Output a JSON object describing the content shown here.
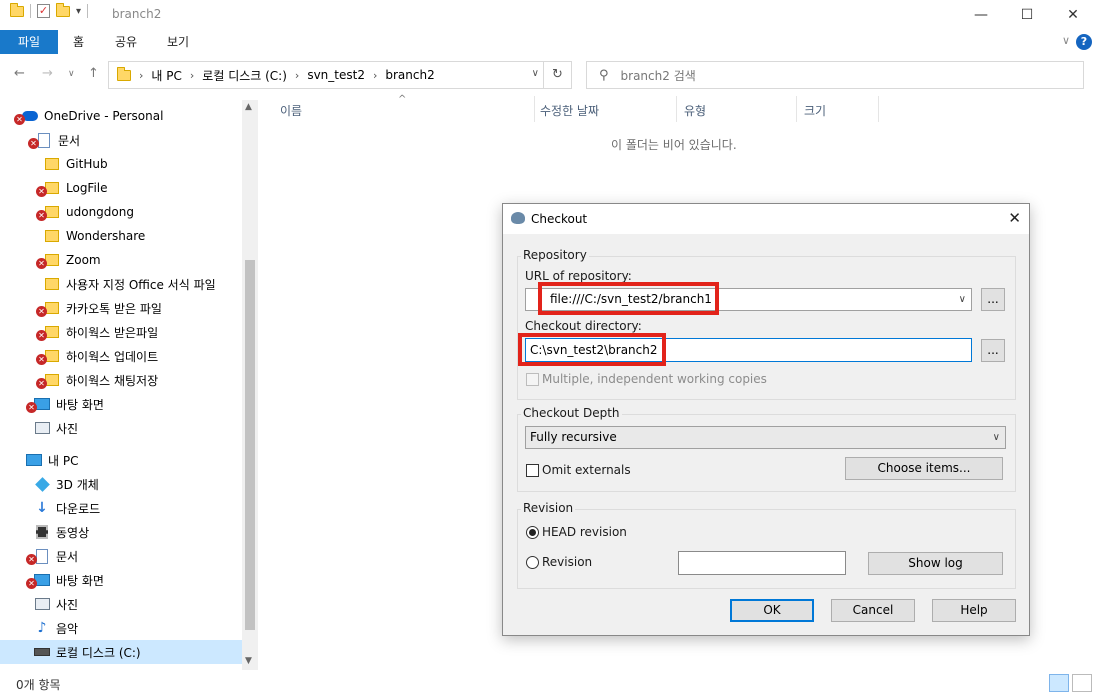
{
  "window": {
    "title": "branch2"
  },
  "ribbon": {
    "tabs": [
      "파일",
      "홈",
      "공유",
      "보기"
    ]
  },
  "address": {
    "crumbs": [
      "내 PC",
      "로컬 디스크 (C:)",
      "svn_test2",
      "branch2"
    ]
  },
  "search": {
    "placeholder": "branch2 검색"
  },
  "nav": {
    "items": [
      {
        "label": "OneDrive - Personal",
        "icon": "cloud-icon",
        "error": true
      },
      {
        "label": "문서",
        "icon": "document-icon",
        "error": true
      },
      {
        "label": "GitHub",
        "icon": "folder-icon",
        "error": false
      },
      {
        "label": "LogFile",
        "icon": "folder-icon",
        "error": true
      },
      {
        "label": "udongdong",
        "icon": "folder-icon",
        "error": true
      },
      {
        "label": "Wondershare",
        "icon": "folder-icon",
        "error": false
      },
      {
        "label": "Zoom",
        "icon": "folder-icon",
        "error": true
      },
      {
        "label": "사용자 지정 Office 서식 파일",
        "icon": "folder-icon",
        "error": false
      },
      {
        "label": "카카오톡 받은 파일",
        "icon": "folder-icon",
        "error": true
      },
      {
        "label": "하이웍스 받은파일",
        "icon": "folder-icon",
        "error": true
      },
      {
        "label": "하이웍스 업데이트",
        "icon": "folder-icon",
        "error": true
      },
      {
        "label": "하이웍스 채팅저장",
        "icon": "folder-icon",
        "error": true
      },
      {
        "label": "바탕 화면",
        "icon": "desktop-icon",
        "error": true
      },
      {
        "label": "사진",
        "icon": "pictures-icon",
        "error": false
      },
      {
        "label": "내 PC",
        "icon": "pc-icon",
        "error": false
      },
      {
        "label": "3D 개체",
        "icon": "3d-objects-icon",
        "error": false
      },
      {
        "label": "다운로드",
        "icon": "download-icon",
        "error": false
      },
      {
        "label": "동영상",
        "icon": "video-icon",
        "error": false
      },
      {
        "label": "문서",
        "icon": "document-icon",
        "error": true
      },
      {
        "label": "바탕 화면",
        "icon": "desktop-icon",
        "error": true
      },
      {
        "label": "사진",
        "icon": "pictures-icon",
        "error": false
      },
      {
        "label": "음악",
        "icon": "music-icon",
        "error": false
      },
      {
        "label": "로컬 디스크 (C:)",
        "icon": "drive-icon",
        "error": false,
        "selected": true
      }
    ]
  },
  "columns": {
    "name": "이름",
    "modified": "수정한 날짜",
    "type": "유형",
    "size": "크기"
  },
  "content": {
    "empty_message": "이 폴더는 비어 있습니다."
  },
  "status": {
    "count": "0개 항목"
  },
  "dialog": {
    "title": "Checkout",
    "repository_group": "Repository",
    "url_label": "URL of repository:",
    "url_value": "file:///C:/svn_test2/branch1",
    "checkout_dir_label": "Checkout directory:",
    "checkout_dir_value": "C:\\svn_test2\\branch2",
    "browse": "...",
    "multiple_copies": "Multiple, independent working copies",
    "depth_group": "Checkout Depth",
    "depth_value": "Fully recursive",
    "omit_externals": "Omit externals",
    "choose_items": "Choose items...",
    "revision_group": "Revision",
    "head_revision": "HEAD revision",
    "revision": "Revision",
    "revision_value": "",
    "show_log": "Show log",
    "ok": "OK",
    "cancel": "Cancel",
    "help": "Help"
  },
  "colors": {
    "highlight_red": "#e2231a",
    "file_tab_blue": "#1979ca",
    "selection": "#cce8ff"
  }
}
